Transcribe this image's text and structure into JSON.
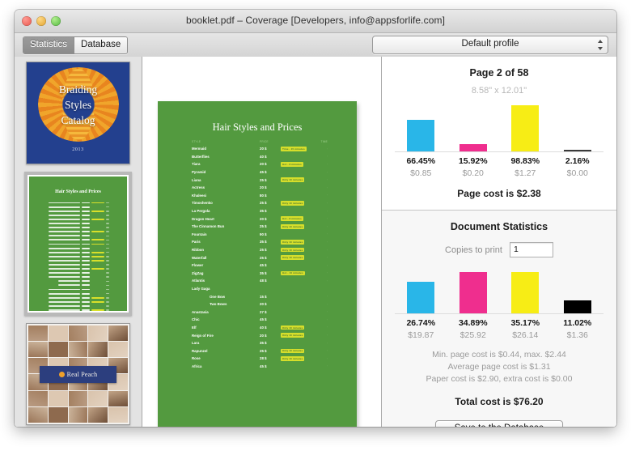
{
  "window": {
    "title": "booklet.pdf – Coverage [Developers, info@appsforlife.com]",
    "traffic_lights": [
      "close",
      "minimize",
      "zoom"
    ]
  },
  "toolbar": {
    "tabs": [
      {
        "label": "Statistics",
        "active": true
      },
      {
        "label": "Database",
        "active": false
      }
    ],
    "profile_select": {
      "value": "Default profile"
    }
  },
  "sidebar": {
    "thumbnails": [
      {
        "name": "catalog-cover",
        "title_lines": [
          "Braiding",
          "Styles",
          "Catalog"
        ],
        "year": "2013",
        "selected": false
      },
      {
        "name": "hair-styles-page",
        "title": "Hair Styles and Prices",
        "selected": true
      },
      {
        "name": "photo-grid-page",
        "banner": "Real Peach",
        "selected": false
      }
    ]
  },
  "preview": {
    "page_title": "Hair Styles and Prices",
    "table": {
      "headers": [
        "STYLE",
        "PRICE",
        "",
        "TIME"
      ],
      "rows": [
        {
          "name": "Mermaid",
          "price": "20 $",
          "badge": "Time - 15 minutes",
          "indent": false
        },
        {
          "name": "Butterflies",
          "price": "40 $",
          "badge": "",
          "indent": false
        },
        {
          "name": "Tiara",
          "price": "20 $",
          "badge": "Hot - 8 minutes",
          "indent": false
        },
        {
          "name": "Pyramid",
          "price": "45 $",
          "badge": "",
          "indent": false
        },
        {
          "name": "Liana",
          "price": "25 $",
          "badge": "Only 10 minutes",
          "indent": false
        },
        {
          "name": "Actress",
          "price": "20 $",
          "badge": "",
          "indent": false
        },
        {
          "name": "Khaleesi",
          "price": "80 $",
          "badge": "",
          "indent": false
        },
        {
          "name": "Timoshenko",
          "price": "25 $",
          "badge": "Only 10 minutes",
          "indent": false
        },
        {
          "name": "La Pergola",
          "price": "35 $",
          "badge": "",
          "indent": false
        },
        {
          "name": "Dragon Heart",
          "price": "20 $",
          "badge": "Hot - 8 minutes",
          "indent": false
        },
        {
          "name": "The Cinnamon Bun",
          "price": "25 $",
          "badge": "Only 10 minutes",
          "indent": false
        },
        {
          "name": "Fountain",
          "price": "90 $",
          "badge": "",
          "indent": false
        },
        {
          "name": "Paris",
          "price": "35 $",
          "badge": "Only 10 minutes",
          "indent": false
        },
        {
          "name": "Ribbon",
          "price": "25 $",
          "badge": "Only 10 minutes",
          "indent": false
        },
        {
          "name": "Waterfall",
          "price": "25 $",
          "badge": "Only 10 minutes",
          "indent": false
        },
        {
          "name": "Flower",
          "price": "45 $",
          "badge": "",
          "indent": false
        },
        {
          "name": "ZigZag",
          "price": "35 $",
          "badge": "Hot - 10 minutes",
          "indent": false
        },
        {
          "name": "Atlantis",
          "price": "48 $",
          "badge": "",
          "indent": false
        },
        {
          "name": "Lady Gaga",
          "price": "",
          "badge": "",
          "indent": false
        },
        {
          "name": "One Bow",
          "price": "15 $",
          "badge": "",
          "indent": true
        },
        {
          "name": "Two Bows",
          "price": "20 $",
          "badge": "",
          "indent": true
        },
        {
          "name": "Anastasia",
          "price": "27 $",
          "badge": "",
          "indent": false
        },
        {
          "name": "Chic",
          "price": "45 $",
          "badge": "",
          "indent": false
        },
        {
          "name": "Elf",
          "price": "40 $",
          "badge": "Only 10 minutes",
          "indent": false
        },
        {
          "name": "Reign of Fire",
          "price": "20 $",
          "badge": "Only 10 minutes",
          "indent": false
        },
        {
          "name": "Lara",
          "price": "35 $",
          "badge": "",
          "indent": false
        },
        {
          "name": "Rapunzel",
          "price": "25 $",
          "badge": "Only 10 minutes",
          "indent": false
        },
        {
          "name": "Rose",
          "price": "28 $",
          "badge": "Only 10 minutes",
          "indent": false
        },
        {
          "name": "Africa",
          "price": "45 $",
          "badge": "",
          "indent": false
        }
      ]
    }
  },
  "page_stats": {
    "heading": "Page 2 of 58",
    "dimensions": "8.58\" x 12.01\"",
    "page_cost": "Page cost is $2.38"
  },
  "doc_stats": {
    "heading": "Document Statistics",
    "copies_label": "Copies to print",
    "copies_value": "1",
    "notes": [
      "Min. page cost is $0.44, max. $2.44",
      "Average page cost is $1.31",
      "Paper cost is $2.90, extra cost is $0.00"
    ],
    "total_cost": "Total cost is $76.20",
    "save_button": "Save to the Database"
  },
  "colors": {
    "cyan": "#29b6e8",
    "magenta": "#ef2e8e",
    "yellow": "#f7ed15",
    "black": "#000000",
    "page_green": "#539a3f",
    "cover_blue": "#23408e"
  },
  "chart_data": [
    {
      "type": "bar",
      "title": "Page 2 of 58",
      "subtitle": "8.58\" x 12.01\"",
      "categories": [
        "Cyan",
        "Magenta",
        "Yellow",
        "Black"
      ],
      "values": [
        66.45,
        15.92,
        98.83,
        2.16
      ],
      "value_labels": [
        "66.45%",
        "15.92%",
        "98.83%",
        "2.16%"
      ],
      "cost_labels": [
        "$0.85",
        "$0.20",
        "$1.27",
        "$0.00"
      ],
      "costs": [
        0.85,
        0.2,
        1.27,
        0.0
      ],
      "colors": [
        "#29b6e8",
        "#ef2e8e",
        "#f7ed15",
        "#3a3a3a"
      ],
      "ylim": [
        0,
        100
      ],
      "ylabel": "",
      "xlabel": "",
      "grid": false,
      "legend": "none",
      "annotation": "Page cost is $2.38"
    },
    {
      "type": "bar",
      "title": "Document Statistics",
      "categories": [
        "Cyan",
        "Magenta",
        "Yellow",
        "Black"
      ],
      "values": [
        26.74,
        34.89,
        35.17,
        11.02
      ],
      "value_labels": [
        "26.74%",
        "34.89%",
        "35.17%",
        "11.02%"
      ],
      "cost_labels": [
        "$19.87",
        "$25.92",
        "$26.14",
        "$1.36"
      ],
      "costs": [
        19.87,
        25.92,
        26.14,
        1.36
      ],
      "colors": [
        "#29b6e8",
        "#ef2e8e",
        "#f7ed15",
        "#000000"
      ],
      "ylim": [
        0,
        40
      ],
      "ylabel": "",
      "xlabel": "",
      "grid": false,
      "legend": "none",
      "annotation": "Total cost is $76.20"
    }
  ]
}
